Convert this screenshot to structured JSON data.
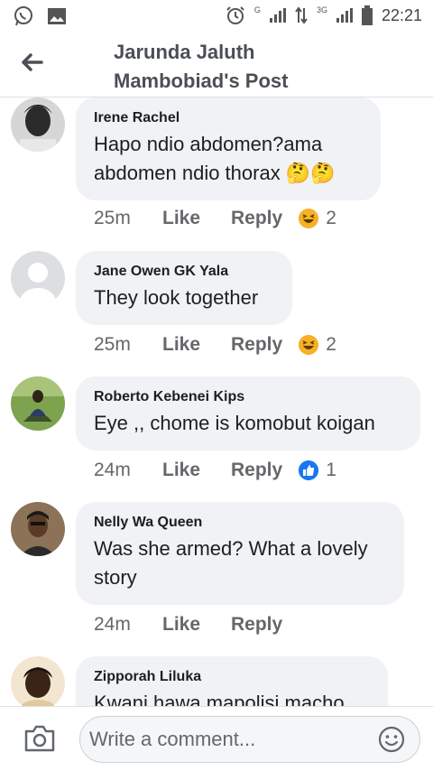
{
  "status_bar": {
    "time": "22:21",
    "network_1": "G",
    "network_2": "3G",
    "icons": [
      "whatsapp-icon",
      "gallery-icon",
      "alarm-icon",
      "signal-icon",
      "data-transfer-icon",
      "battery-icon"
    ]
  },
  "header": {
    "title": "Jarunda Jaluth Mambobiad's Post",
    "back_icon": "arrow-left-icon"
  },
  "comments": [
    {
      "author": "Irene Rachel",
      "text": "Hapo ndio abdomen?ama abdomen ndio thorax 🤔🤔",
      "time": "25m",
      "like_label": "Like",
      "reply_label": "Reply",
      "reaction": "haha",
      "reaction_count": "2"
    },
    {
      "author": "Jane Owen GK Yala",
      "text": "They look together",
      "time": "25m",
      "like_label": "Like",
      "reply_label": "Reply",
      "reaction": "haha",
      "reaction_count": "2"
    },
    {
      "author": "Roberto Kebenei Kips",
      "text": "Eye ,,  chome is komobut koigan",
      "time": "24m",
      "like_label": "Like",
      "reply_label": "Reply",
      "reaction": "like",
      "reaction_count": "1"
    },
    {
      "author": "Nelly Wa Queen",
      "text": "Was she armed? What a lovely story",
      "time": "24m",
      "like_label": "Like",
      "reply_label": "Reply",
      "reaction": "",
      "reaction_count": ""
    },
    {
      "author": "Zipporah Liluka",
      "text": "Kwani hawa mapolisi macho",
      "time": "",
      "like_label": "",
      "reply_label": "",
      "reaction": "",
      "reaction_count": ""
    }
  ],
  "composer": {
    "placeholder": "Write a comment...",
    "camera_icon": "camera-icon",
    "emoji_icon": "smiley-icon"
  },
  "colors": {
    "bubble": "#f0f2f5",
    "meta_text": "#65676b",
    "haha_yellow": "#f7b125",
    "like_blue": "#1877f2"
  }
}
